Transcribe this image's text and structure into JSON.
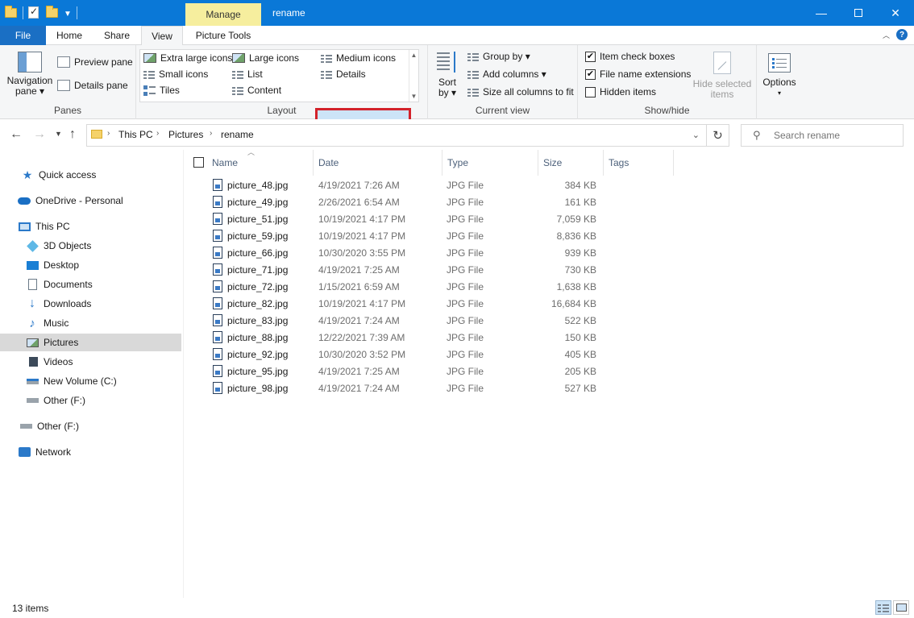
{
  "window": {
    "title": "rename",
    "context_tab": "Manage",
    "controls": {
      "minimize": "—",
      "maximize": "",
      "close": "✕"
    }
  },
  "ribbon_tabs": [
    {
      "label": "File"
    },
    {
      "label": "Home"
    },
    {
      "label": "Share"
    },
    {
      "label": "View"
    },
    {
      "label": "Picture Tools"
    }
  ],
  "ribbon": {
    "panes": {
      "label": "Panes",
      "navigation_pane": "Navigation",
      "navigation_pane_2": "pane ▾",
      "preview_pane": "Preview pane",
      "details_pane": "Details pane"
    },
    "layout": {
      "label": "Layout",
      "items": [
        "Extra large icons",
        "Large icons",
        "Medium icons",
        "Small icons",
        "List",
        "Details",
        "Tiles",
        "Content"
      ]
    },
    "current_view": {
      "label": "Current view",
      "sort_by": "Sort",
      "sort_by_2": "by ▾",
      "group_by": "Group by ▾",
      "add_columns": "Add columns ▾",
      "size_columns": "Size all columns to fit"
    },
    "show_hide": {
      "label": "Show/hide",
      "item_check_boxes": "Item check boxes",
      "file_name_extensions": "File name extensions",
      "hidden_items": "Hidden items",
      "hide_selected": "Hide selected",
      "hide_selected_2": "items"
    },
    "options": {
      "label": "Options",
      "arrow": "▾"
    }
  },
  "address": {
    "crumbs": [
      "This PC",
      "Pictures",
      "rename"
    ],
    "search_placeholder": "Search rename"
  },
  "sidebar": {
    "items": [
      {
        "label": "Quick access"
      },
      {
        "label": "OneDrive - Personal"
      },
      {
        "label": "This PC"
      },
      {
        "label": "3D Objects"
      },
      {
        "label": "Desktop"
      },
      {
        "label": "Documents"
      },
      {
        "label": "Downloads"
      },
      {
        "label": "Music"
      },
      {
        "label": "Pictures"
      },
      {
        "label": "Videos"
      },
      {
        "label": "New Volume (C:)"
      },
      {
        "label": "Other (F:)"
      },
      {
        "label": "Other (F:)"
      },
      {
        "label": "Network"
      }
    ]
  },
  "columns": [
    "Name",
    "Date",
    "Type",
    "Size",
    "Tags"
  ],
  "files": [
    {
      "name": "picture_48.jpg",
      "date": "4/19/2021 7:26 AM",
      "type": "JPG File",
      "size": "384 KB"
    },
    {
      "name": "picture_49.jpg",
      "date": "2/26/2021 6:54 AM",
      "type": "JPG File",
      "size": "161 KB"
    },
    {
      "name": "picture_51.jpg",
      "date": "10/19/2021 4:17 PM",
      "type": "JPG File",
      "size": "7,059 KB"
    },
    {
      "name": "picture_59.jpg",
      "date": "10/19/2021 4:17 PM",
      "type": "JPG File",
      "size": "8,836 KB"
    },
    {
      "name": "picture_66.jpg",
      "date": "10/30/2020 3:55 PM",
      "type": "JPG File",
      "size": "939 KB"
    },
    {
      "name": "picture_71.jpg",
      "date": "4/19/2021 7:25 AM",
      "type": "JPG File",
      "size": "730 KB"
    },
    {
      "name": "picture_72.jpg",
      "date": "1/15/2021 6:59 AM",
      "type": "JPG File",
      "size": "1,638 KB"
    },
    {
      "name": "picture_82.jpg",
      "date": "10/19/2021 4:17 PM",
      "type": "JPG File",
      "size": "16,684 KB"
    },
    {
      "name": "picture_83.jpg",
      "date": "4/19/2021 7:24 AM",
      "type": "JPG File",
      "size": "522 KB"
    },
    {
      "name": "picture_88.jpg",
      "date": "12/22/2021 7:39 AM",
      "type": "JPG File",
      "size": "150 KB"
    },
    {
      "name": "picture_92.jpg",
      "date": "10/30/2020 3:52 PM",
      "type": "JPG File",
      "size": "405 KB"
    },
    {
      "name": "picture_95.jpg",
      "date": "4/19/2021 7:25 AM",
      "type": "JPG File",
      "size": "205 KB"
    },
    {
      "name": "picture_98.jpg",
      "date": "4/19/2021 7:24 AM",
      "type": "JPG File",
      "size": "527 KB"
    }
  ],
  "status": {
    "item_count": "13 items"
  },
  "colors": {
    "titlebar": "#0a78d7",
    "file_tab": "#1a6fc4",
    "manage_tab": "#f6ee9e",
    "highlight": "#d3222a",
    "selected_nav": "#d9d9d9"
  }
}
